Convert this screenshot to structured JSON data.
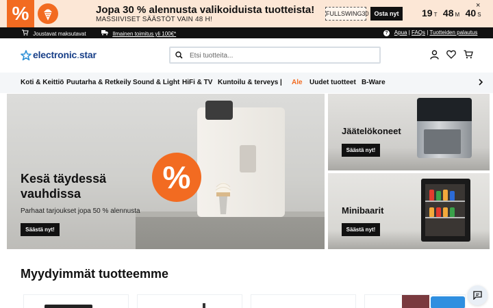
{
  "promo": {
    "badge": "%",
    "title": "Jopa 30 % alennusta valikoiduista tuotteista!",
    "subtitle": "MASSIIVISET SÄÄSTÖT VAIN 48 H!",
    "code": "FULLSWING30",
    "cta": "Osta nyt",
    "countdown": {
      "hours": "19",
      "hours_unit": "T",
      "minutes": "48",
      "minutes_unit": "M",
      "seconds": "40",
      "seconds_unit": "S"
    },
    "close": "×"
  },
  "infobar": {
    "left": "Joustavat maksutavat",
    "middle": "Ilmainen toimitus yli 100€*",
    "links": [
      "Apua",
      "FAQs",
      "Tuotteiden palautus"
    ],
    "separator": " | "
  },
  "header": {
    "logo_main": "electronic",
    "logo_sep": ".",
    "logo_tail": "star",
    "search_placeholder": "Etsi tuotteita..."
  },
  "nav": {
    "categories": [
      "Koti & Keittiö",
      "Puutarha & Retkeily",
      "Sound & Light",
      "HiFi & TV",
      "Kuntoilu & terveys",
      "|",
      "Ale",
      "Uudet tuotteet",
      "B-Ware"
    ]
  },
  "hero": {
    "badge": "%",
    "title": "Kesä täydessä vauhdissa",
    "subtitle": "Parhaat tarjoukset jopa 50 % alennusta",
    "cta": "Säästä nyt!"
  },
  "tiles": [
    {
      "title": "Jäätelökoneet",
      "cta": "Säästä nyt!"
    },
    {
      "title": "Minibaarit",
      "cta": "Säästä nyt!"
    }
  ],
  "bestsellers": {
    "title": "Myydyimmät tuotteemme"
  },
  "colors": {
    "accent": "#f26b21",
    "brand": "#173e87",
    "dark": "#111111",
    "promo_bg": "#fce7d6"
  }
}
